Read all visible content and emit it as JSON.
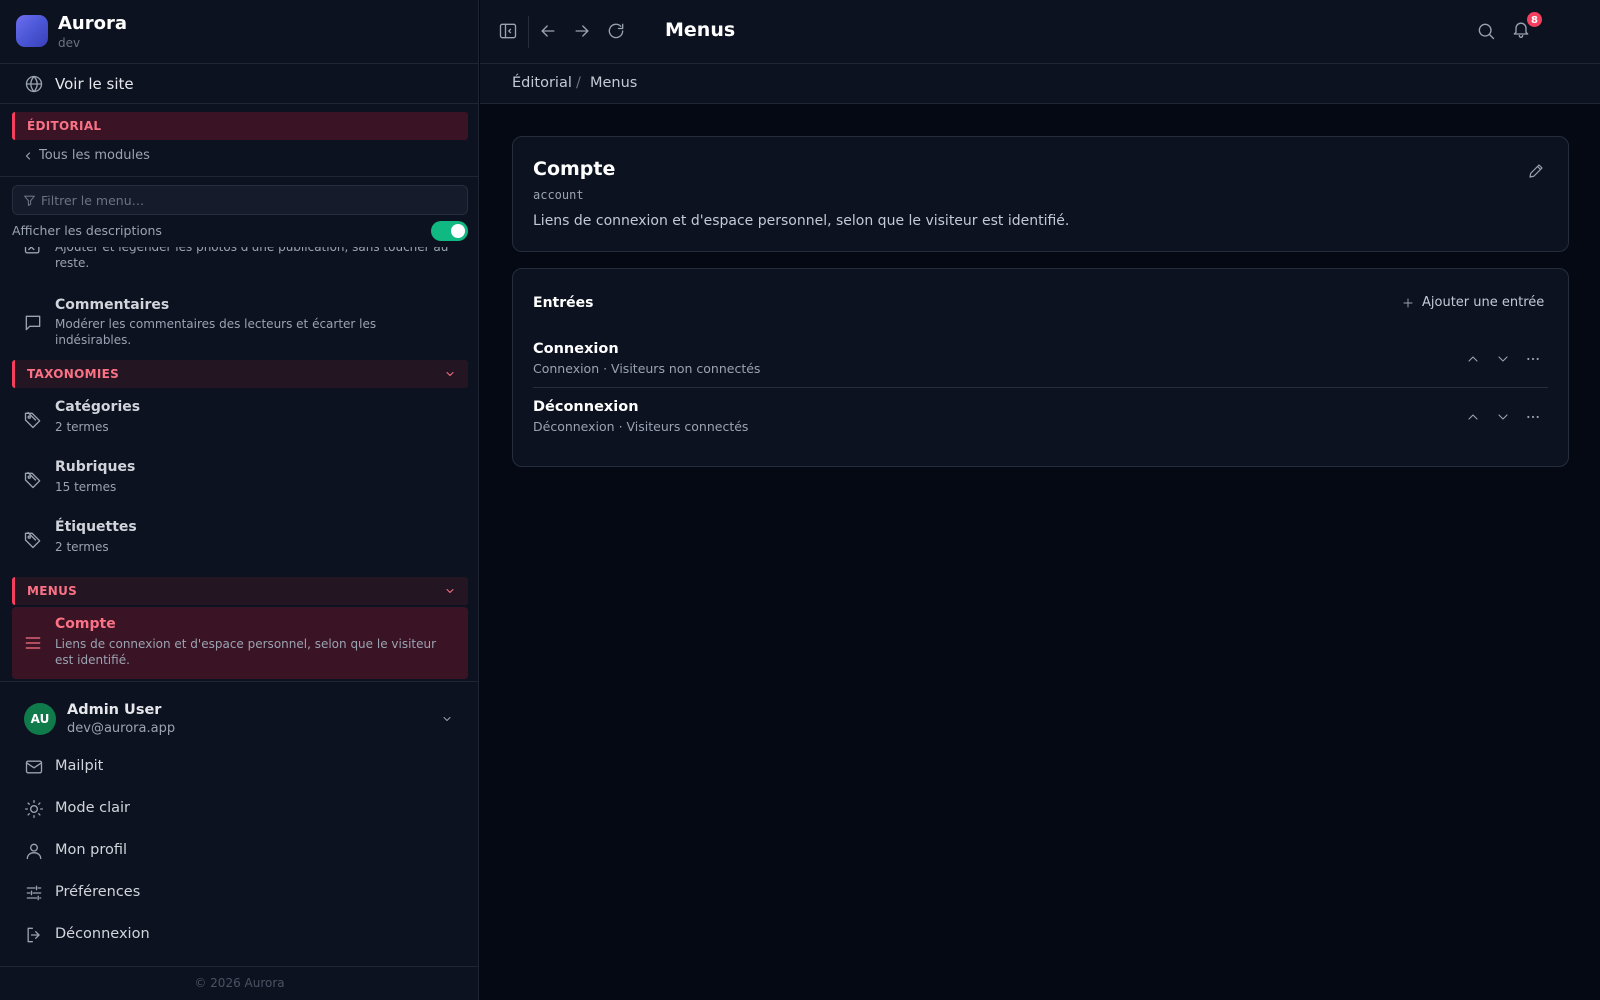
{
  "brand": {
    "name": "Aurora",
    "env": "dev"
  },
  "visit_site": "Voir le site",
  "module": {
    "name": "ÉDITORIAL",
    "back_label": "Tous les modules"
  },
  "filter": {
    "placeholder": "Filtrer le menu…"
  },
  "show_descriptions": {
    "label": "Afficher les descriptions",
    "enabled": true
  },
  "nav": {
    "partial_item": {
      "desc": "Ajouter et légender les photos d'une publication, sans toucher au reste."
    },
    "comments": {
      "title": "Commentaires",
      "desc": "Modérer les commentaires des lecteurs et écarter les indésirables."
    },
    "taxonomies": {
      "label": "TAXONOMIES",
      "items": [
        {
          "title": "Catégories",
          "desc": "2 termes"
        },
        {
          "title": "Rubriques",
          "desc": "15 termes"
        },
        {
          "title": "Étiquettes",
          "desc": "2 termes"
        }
      ]
    },
    "menus": {
      "label": "MENUS",
      "items": [
        {
          "title": "Compte",
          "desc": "Liens de connexion et d'espace personnel, selon que le visiteur est identifié."
        }
      ]
    }
  },
  "user": {
    "initials": "AU",
    "name": "Admin User",
    "email": "dev@aurora.app"
  },
  "bottom_menu": [
    "Mailpit",
    "Mode clair",
    "Mon profil",
    "Préférences",
    "Déconnexion"
  ],
  "copyright": "© 2026 Aurora",
  "topbar": {
    "title": "Menus",
    "notifications": "8"
  },
  "breadcrumb": [
    "Éditorial",
    "Menus"
  ],
  "menu_card": {
    "title": "Compte",
    "slug": "account",
    "description": "Liens de connexion et d'espace personnel, selon que le visiteur est identifié."
  },
  "entries": {
    "title": "Entrées",
    "add_label": "Ajouter une entrée",
    "items": [
      {
        "title": "Connexion",
        "subtitle": "Connexion · Visiteurs non connectés"
      },
      {
        "title": "Déconnexion",
        "subtitle": "Déconnexion · Visiteurs connectés"
      }
    ]
  },
  "colors": {
    "accent": "#f43f5e",
    "toggle_on": "#10b981",
    "avatar": "#0f7a4a",
    "background": "#050913",
    "panel": "#0d1220"
  }
}
